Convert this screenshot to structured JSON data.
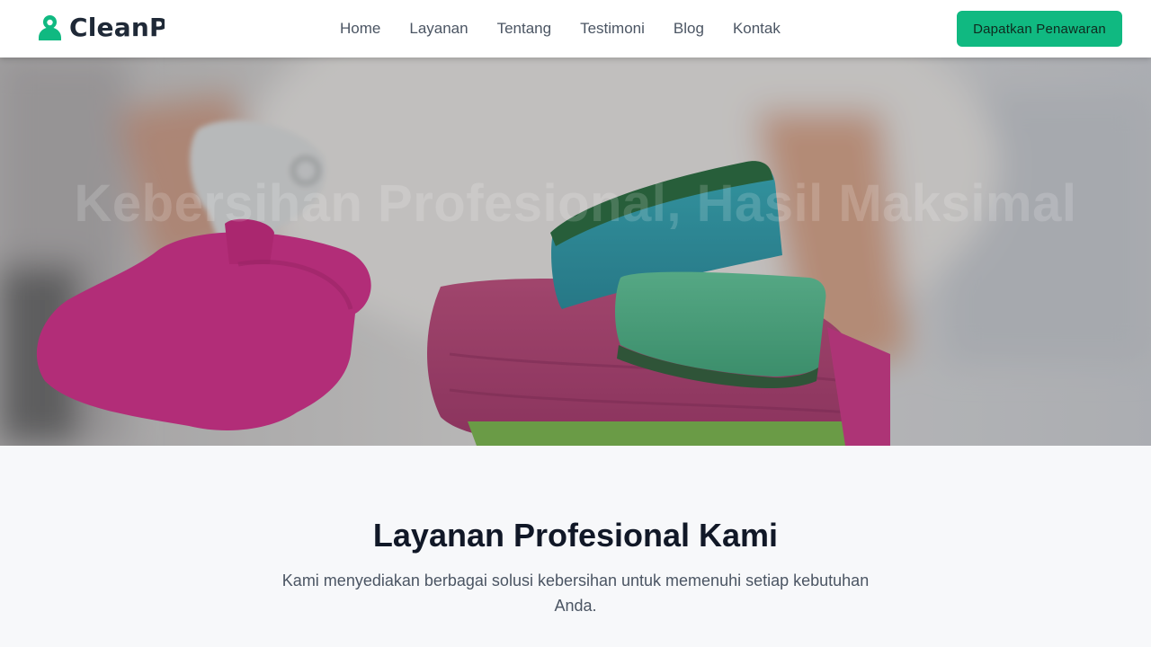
{
  "brand": {
    "name": "CleanP",
    "icon": "person-pin-icon",
    "color": "#10b981"
  },
  "nav": {
    "items": [
      {
        "label": "Home"
      },
      {
        "label": "Layanan"
      },
      {
        "label": "Tentang"
      },
      {
        "label": "Testimoni"
      },
      {
        "label": "Blog"
      },
      {
        "label": "Kontak"
      }
    ],
    "cta_label": "Dapatkan Penawaran",
    "cta_color": "#10b981"
  },
  "hero": {
    "title": "Kebersihan Profesional, Hasil Maksimal",
    "image": "cleaning-gloves-sponges-photo"
  },
  "services": {
    "title": "Layanan Profesional Kami",
    "subtitle": "Kami menyediakan berbagai solusi kebersihan untuk memenuhi setiap kebutuhan Anda."
  }
}
